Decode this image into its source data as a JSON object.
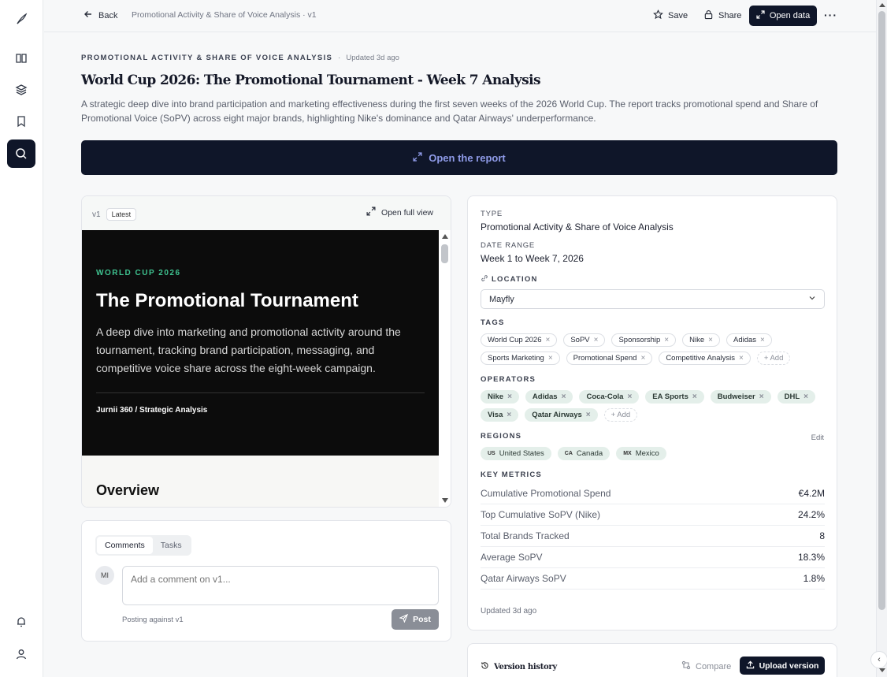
{
  "topbar": {
    "back_label": "Back",
    "breadcrumb": "Promotional Activity & Share of Voice Analysis · v1",
    "save_label": "Save",
    "share_label": "Share",
    "open_data_label": "Open data",
    "more_label": "···"
  },
  "header": {
    "eyebrow": "PROMOTIONAL ACTIVITY & SHARE OF VOICE ANALYSIS",
    "updated": "Updated 3d ago",
    "title": "World Cup 2026: The Promotional Tournament - Week 7 Analysis",
    "description": "A strategic deep dive into brand participation and marketing effectiveness during the first seven weeks of the 2026 World Cup. The report tracks promotional spend and Share of Promotional Voice (SoPV) across eight major brands, highlighting Nike's dominance and Qatar Airways' underperformance.",
    "open_report_label": "Open the report"
  },
  "preview": {
    "version": "v1",
    "latest_badge": "Latest",
    "open_full_label": "Open full view",
    "hero_eyebrow": "WORLD CUP 2026",
    "hero_title": "The Promotional Tournament",
    "hero_desc": "A deep dive into marketing and promotional activity around the tournament, tracking brand participation, messaging, and competitive voice share across the eight-week campaign.",
    "byline": "Jurnii 360 / Strategic Analysis",
    "overview_heading": "Overview"
  },
  "comments": {
    "tab_comments": "Comments",
    "tab_tasks": "Tasks",
    "avatar_initials": "MI",
    "placeholder": "Add a comment on v1...",
    "posting_against": "Posting against v1",
    "post_label": "Post"
  },
  "details": {
    "type_label": "TYPE",
    "type_value": "Promotional Activity & Share of Voice Analysis",
    "date_label": "DATE RANGE",
    "date_value": "Week 1 to Week 7, 2026",
    "location_label": "LOCATION",
    "location_value": "Mayfly",
    "tags_label": "TAGS",
    "tags": [
      "World Cup 2026",
      "SoPV",
      "Sponsorship",
      "Nike",
      "Adidas",
      "Sports Marketing",
      "Promotional Spend",
      "Competitive Analysis"
    ],
    "add_label": "+ Add",
    "operators_label": "OPERATORS",
    "operators": [
      "Nike",
      "Adidas",
      "Coca-Cola",
      "EA Sports",
      "Budweiser",
      "DHL",
      "Visa",
      "Qatar Airways"
    ],
    "regions_label": "REGIONS",
    "edit_label": "Edit",
    "regions": [
      {
        "code": "US",
        "name": "United States"
      },
      {
        "code": "CA",
        "name": "Canada"
      },
      {
        "code": "MX",
        "name": "Mexico"
      }
    ],
    "metrics_label": "KEY METRICS",
    "metrics": [
      {
        "key": "Cumulative Promotional Spend",
        "value": "€4.2M"
      },
      {
        "key": "Top Cumulative SoPV (Nike)",
        "value": "24.2%"
      },
      {
        "key": "Total Brands Tracked",
        "value": "8"
      },
      {
        "key": "Average SoPV",
        "value": "18.3%"
      },
      {
        "key": "Qatar Airways SoPV",
        "value": "1.8%"
      }
    ],
    "updated": "Updated 3d ago"
  },
  "version_history": {
    "title": "Version history",
    "compare_label": "Compare",
    "upload_label": "Upload version"
  }
}
